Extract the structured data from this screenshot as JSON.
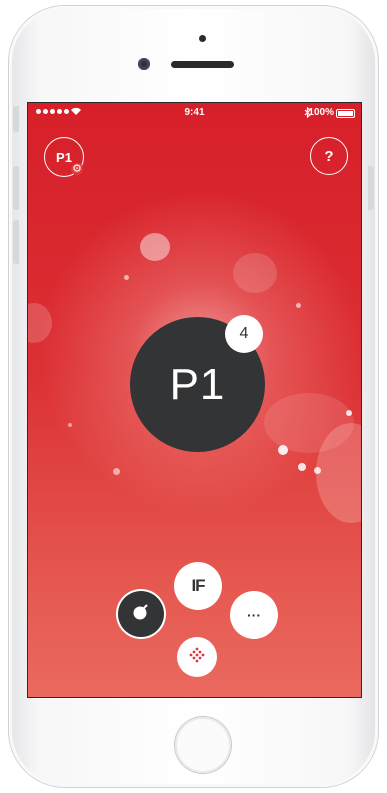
{
  "status_bar": {
    "time": "9:41",
    "bluetooth_icon": "bluetooth-icon",
    "battery_percent": "100%"
  },
  "header": {
    "profile_button_label": "P1",
    "settings_icon": "gear-icon",
    "help_button_label": "?"
  },
  "main": {
    "active_profile_label": "P1",
    "notification_count": "4"
  },
  "actions": [
    {
      "name": "theme-button",
      "icon": "bomb-icon",
      "label": ""
    },
    {
      "name": "ifttt-button",
      "icon": "ifttt-icon",
      "label": "IF"
    },
    {
      "name": "more-button",
      "icon": "ellipsis-icon",
      "label": "···"
    },
    {
      "name": "grid-button",
      "icon": "dot-diamond-icon",
      "label": ""
    }
  ],
  "colors": {
    "background_top": "#d71f29",
    "background_bottom": "#ea6a5f",
    "dark_circle": "#333436",
    "accent": "#d63a3f"
  }
}
